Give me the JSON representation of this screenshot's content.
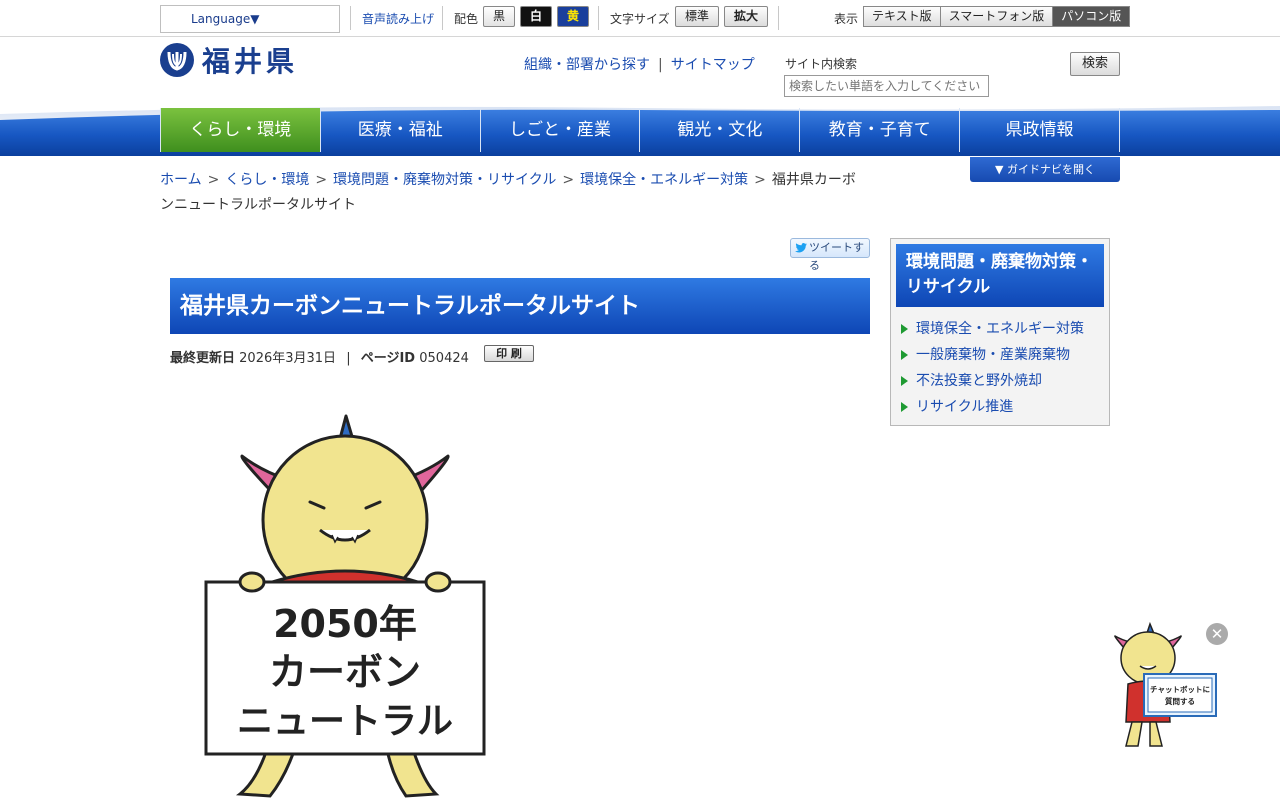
{
  "topbar": {
    "language_label": "Language▼",
    "voice_label": "音声読み上げ",
    "color_label": "配色",
    "color_black": "黒",
    "color_white": "白",
    "color_yellow": "黄",
    "fontsize_label": "文字サイズ",
    "fontsize_normal": "標準",
    "fontsize_large": "拡大",
    "display_label": "表示",
    "display_text": "テキスト版",
    "display_smartphone": "スマートフォン版",
    "display_pc": "パソコン版"
  },
  "header": {
    "logo_text": "福井県",
    "link_org": "組織・部署から探す",
    "link_sitemap": "サイトマップ",
    "search_label": "サイト内検索",
    "search_placeholder": "検索したい単語を入力してください",
    "search_button": "検索"
  },
  "nav": {
    "items": [
      {
        "label": "くらし・環境"
      },
      {
        "label": "医療・福祉"
      },
      {
        "label": "しごと・産業"
      },
      {
        "label": "観光・文化"
      },
      {
        "label": "教育・子育て"
      },
      {
        "label": "県政情報"
      }
    ],
    "guide_button": "▼ ガイドナビを開く"
  },
  "breadcrumb": {
    "home": "ホーム",
    "level1": "くらし・環境",
    "level2": "環境問題・廃棄物対策・リサイクル",
    "level3": "環境保全・エネルギー対策",
    "current": "福井県カーボンニュートラルポータルサイト",
    "separator": ">"
  },
  "main": {
    "tweet_label": "ツイートする",
    "title": "福井県カーボンニュートラルポータルサイト",
    "updated_label": "最終更新日",
    "updated_date": "2026年3月31日",
    "meta_separator": "|",
    "page_id_label": "ページID",
    "page_id": "050424",
    "print_label": "印 刷",
    "hero_line1": "2050年",
    "hero_line2": "カーボン",
    "hero_line3": "ニュートラル"
  },
  "side": {
    "title": "環境問題・廃棄物対策・リサイクル",
    "items": [
      {
        "label": "環境保全・エネルギー対策"
      },
      {
        "label": "一般廃棄物・産業廃棄物"
      },
      {
        "label": "不法投棄と野外焼却"
      },
      {
        "label": "リサイクル推進"
      }
    ]
  },
  "chatbot": {
    "line1": "チャットボットに",
    "line2": "質問する",
    "close_glyph": "✕"
  },
  "colors": {
    "nav_blue": "#1757c2",
    "nav_active_green": "#5aa82e",
    "link_blue": "#1a4cb0",
    "title_blue": "#0e46b5"
  }
}
